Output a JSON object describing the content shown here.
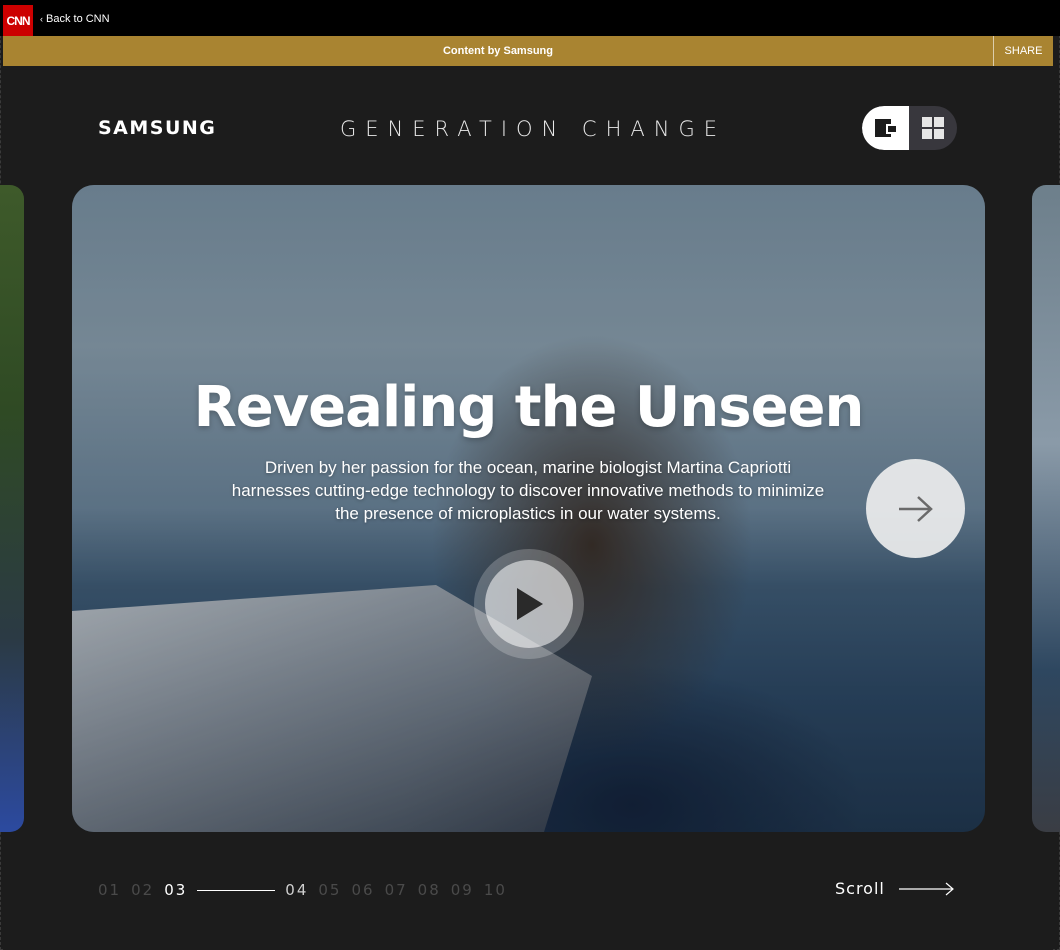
{
  "topbar": {
    "logo": "CNN",
    "back_label": "Back to CNN"
  },
  "sponsor": {
    "content_by": "Content by Samsung",
    "share_label": "SHARE",
    "color": "#a98431"
  },
  "header": {
    "brand": "SAMSUNG",
    "title": "GENERATION CHANGE"
  },
  "view_toggle": {
    "options": [
      "single-view",
      "grid-view"
    ],
    "selected": "single-view"
  },
  "card": {
    "title": "Revealing the Unseen",
    "description": "Driven by her passion for the ocean, marine biologist Martina Capriotti harnesses cutting-edge technology to discover innovative methods to minimize the presence of microplastics in our water systems."
  },
  "pagination": {
    "pages": [
      "01",
      "02",
      "03",
      "04",
      "05",
      "06",
      "07",
      "08",
      "09",
      "10"
    ],
    "current": "03",
    "next": "04"
  },
  "scroll_label": "Scroll",
  "colors": {
    "background": "#1c1c1c",
    "cnn_red": "#cc0000",
    "gold": "#a98431"
  }
}
